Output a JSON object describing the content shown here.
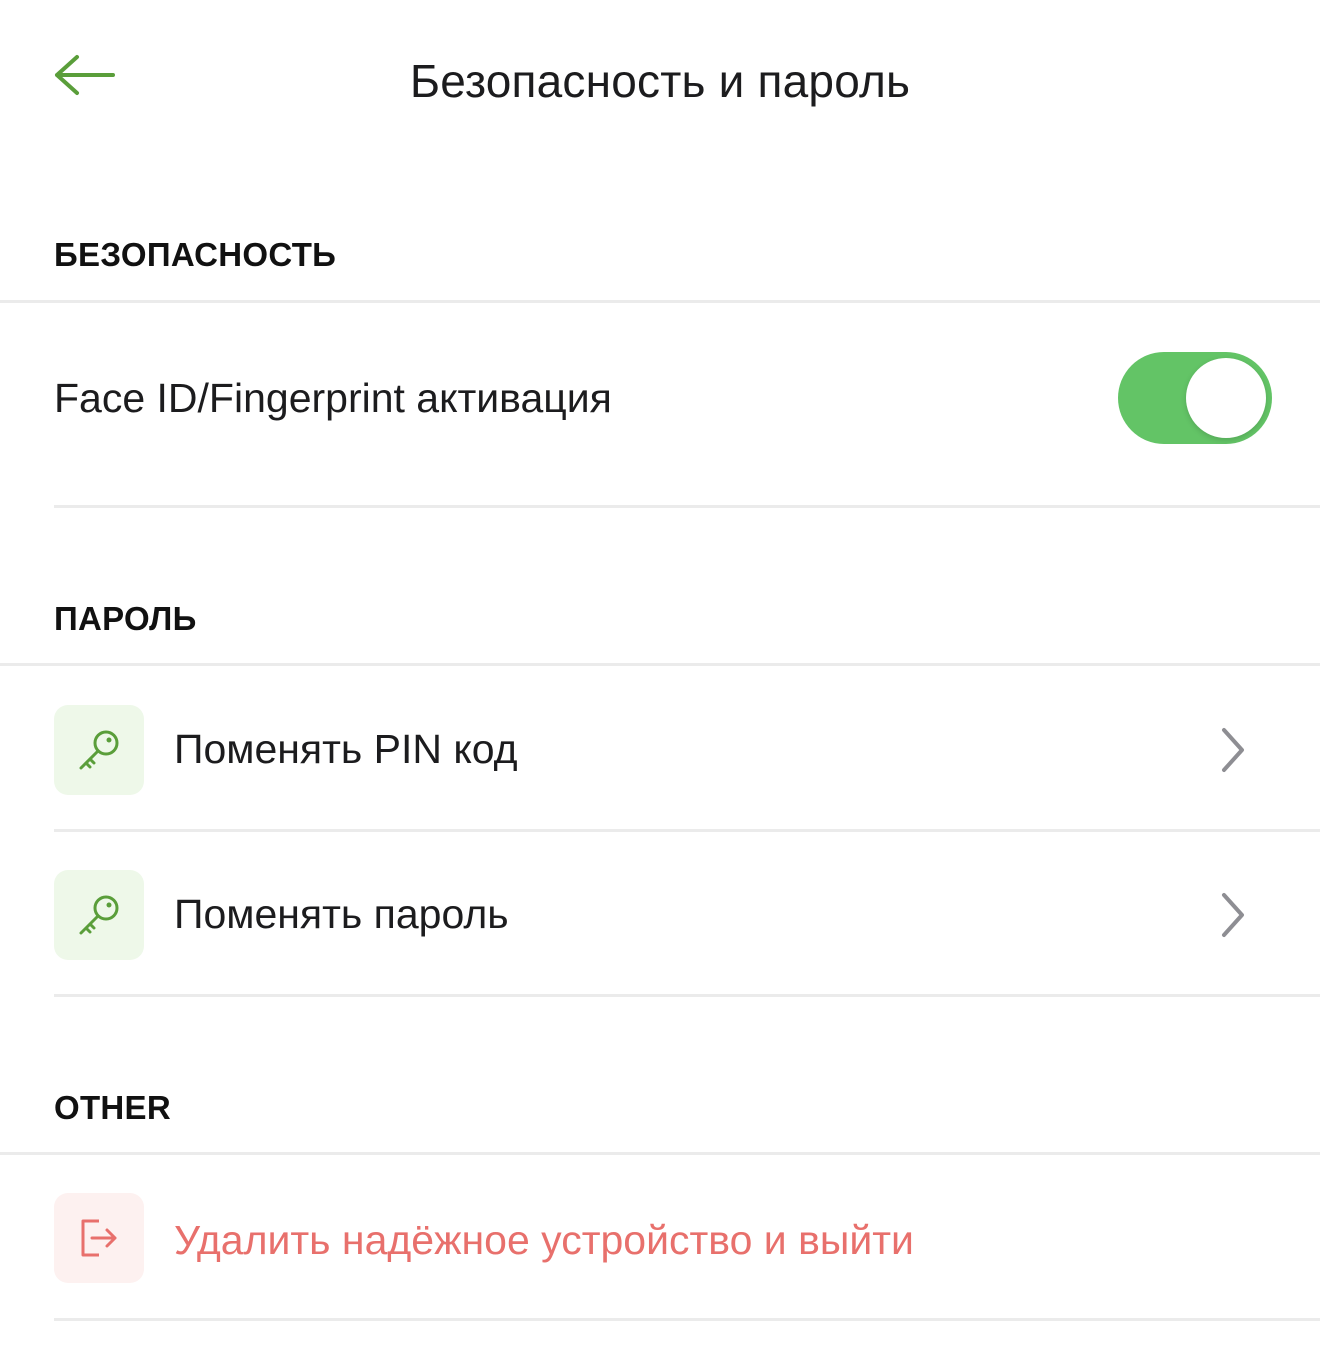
{
  "header": {
    "title": "Безопасность и пароль",
    "back_icon": "arrow-left-icon",
    "accent_color": "#5a9e3a"
  },
  "sections": {
    "security": {
      "title": "БЕЗОПАСНОСТЬ",
      "biometric": {
        "label": "Face ID/Fingerprint активация",
        "enabled": true,
        "toggle_color": "#63c466"
      }
    },
    "password": {
      "title": "ПАРОЛЬ",
      "items": [
        {
          "label": "Поменять PIN код",
          "icon": "key-icon",
          "chevron": "chevron-right-icon"
        },
        {
          "label": "Поменять пароль",
          "icon": "key-icon",
          "chevron": "chevron-right-icon"
        }
      ]
    },
    "other": {
      "title": "OTHER",
      "logout": {
        "label": "Удалить надёжное устройство и выйти",
        "icon": "logout-icon",
        "color": "#e8706c"
      }
    }
  }
}
